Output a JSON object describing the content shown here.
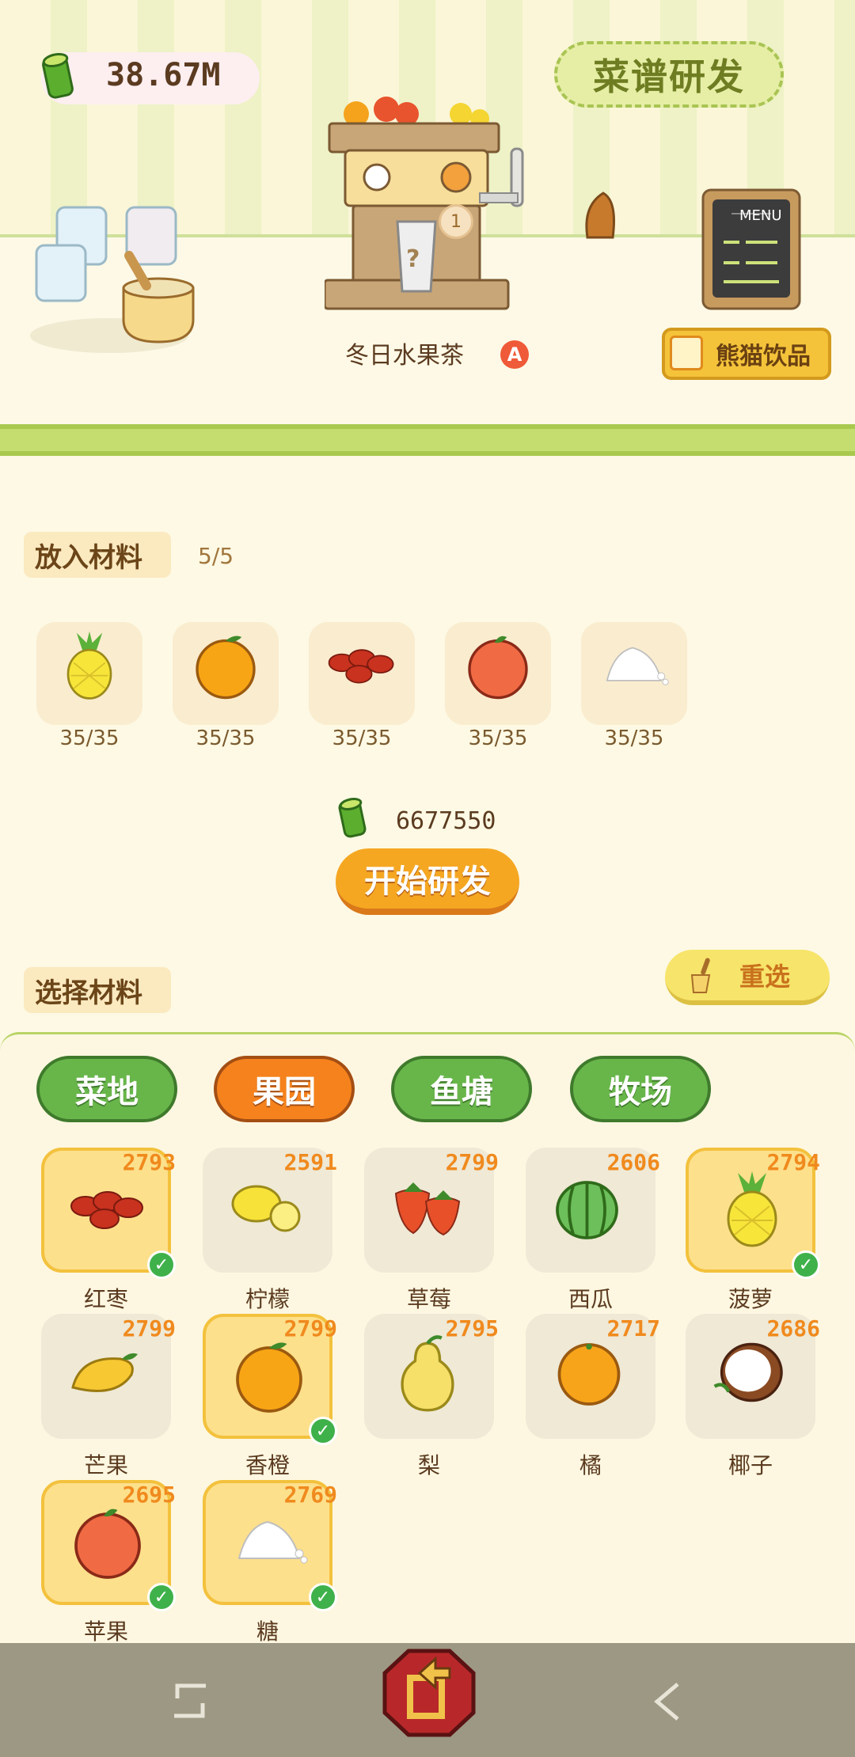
{
  "header": {
    "currency": "38.67M",
    "research_button": "菜谱研发",
    "drink_name": "冬日水果茶",
    "drink_badge": "A",
    "machine_badge": "1",
    "machine_question": "?",
    "menu_title": "MENU",
    "panda_button": "熊猫饮品"
  },
  "ingredients_in": {
    "label": "放入材料",
    "count": "5/5",
    "slots": [
      {
        "item": "pineapple",
        "count": "35/35"
      },
      {
        "item": "orange",
        "count": "35/35"
      },
      {
        "item": "red-date",
        "count": "35/35"
      },
      {
        "item": "apple",
        "count": "35/35"
      },
      {
        "item": "sugar",
        "count": "35/35"
      }
    ]
  },
  "cost": "6677550",
  "start_button": "开始研发",
  "choose": {
    "label": "选择材料",
    "reselect_button": "重选"
  },
  "tabs": [
    {
      "label": "菜地",
      "active": false
    },
    {
      "label": "果园",
      "active": true
    },
    {
      "label": "鱼塘",
      "active": false
    },
    {
      "label": "牧场",
      "active": false
    }
  ],
  "items": [
    {
      "name": "红枣",
      "count": "2793",
      "selected": true,
      "icon": "red-date"
    },
    {
      "name": "柠檬",
      "count": "2591",
      "selected": false,
      "icon": "lemon"
    },
    {
      "name": "草莓",
      "count": "2799",
      "selected": false,
      "icon": "strawberry"
    },
    {
      "name": "西瓜",
      "count": "2606",
      "selected": false,
      "icon": "watermelon"
    },
    {
      "name": "菠萝",
      "count": "2794",
      "selected": true,
      "icon": "pineapple"
    },
    {
      "name": "芒果",
      "count": "2799",
      "selected": false,
      "icon": "mango"
    },
    {
      "name": "香橙",
      "count": "2799",
      "selected": true,
      "icon": "orange"
    },
    {
      "name": "梨",
      "count": "2795",
      "selected": false,
      "icon": "pear"
    },
    {
      "name": "橘",
      "count": "2717",
      "selected": false,
      "icon": "tangerine"
    },
    {
      "name": "椰子",
      "count": "2686",
      "selected": false,
      "icon": "coconut"
    },
    {
      "name": "苹果",
      "count": "2695",
      "selected": true,
      "icon": "apple"
    },
    {
      "name": "糖",
      "count": "2769",
      "selected": true,
      "icon": "sugar"
    }
  ],
  "colors": {
    "accent": "#f5821d",
    "tab_green": "#68b64a",
    "count_orange": "#f08a1e"
  }
}
